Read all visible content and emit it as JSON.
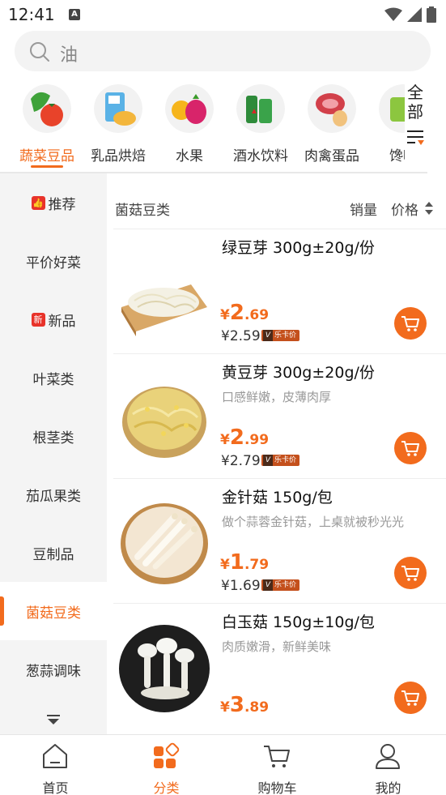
{
  "status_bar": {
    "time": "12:41",
    "a_icon": "A"
  },
  "search": {
    "text": "油"
  },
  "categories": [
    {
      "label": "蔬菜豆品",
      "active": true
    },
    {
      "label": "乳品烘焙",
      "active": false
    },
    {
      "label": "水果",
      "active": false
    },
    {
      "label": "酒水饮料",
      "active": false
    },
    {
      "label": "肉禽蛋品",
      "active": false
    },
    {
      "label": "馋嘴",
      "active": false
    }
  ],
  "category_all": {
    "line1": "全",
    "line2": "部"
  },
  "sidebar": {
    "items": [
      {
        "label": "推荐",
        "badge": "👍",
        "active": false
      },
      {
        "label": "平价好菜",
        "badge": "",
        "active": false
      },
      {
        "label": "新品",
        "badge": "新",
        "active": false
      },
      {
        "label": "叶菜类",
        "badge": "",
        "active": false
      },
      {
        "label": "根茎类",
        "badge": "",
        "active": false
      },
      {
        "label": "茄瓜果类",
        "badge": "",
        "active": false
      },
      {
        "label": "豆制品",
        "badge": "",
        "active": false
      },
      {
        "label": "菌菇豆类",
        "badge": "",
        "active": true
      },
      {
        "label": "葱蒜调味",
        "badge": "",
        "active": false
      }
    ]
  },
  "list_header": {
    "title": "菌菇豆类",
    "sort_sales": "销量",
    "sort_price": "价格"
  },
  "products": [
    {
      "name": "绿豆芽 300g±20g/份",
      "desc": "",
      "yen": "¥",
      "price_int": "2",
      "price_dec": ".69",
      "card_price": "¥2.59",
      "card_label": "乐卡价"
    },
    {
      "name": "黄豆芽 300g±20g/份",
      "desc": "口感鲜嫩，皮薄肉厚",
      "yen": "¥",
      "price_int": "2",
      "price_dec": ".99",
      "card_price": "¥2.79",
      "card_label": "乐卡价"
    },
    {
      "name": "金针菇 150g/包",
      "desc": "做个蒜蓉金针菇，上桌就被秒光光",
      "yen": "¥",
      "price_int": "1",
      "price_dec": ".79",
      "card_price": "¥1.69",
      "card_label": "乐卡价"
    },
    {
      "name": "白玉菇 150g±10g/包",
      "desc": "肉质嫩滑，新鲜美味",
      "yen": "¥",
      "price_int": "3",
      "price_dec": ".89",
      "card_price": "",
      "card_label": ""
    }
  ],
  "bottom_nav": [
    {
      "label": "首页",
      "icon": "home-icon",
      "active": false
    },
    {
      "label": "分类",
      "icon": "category-icon",
      "active": true
    },
    {
      "label": "购物车",
      "icon": "cart-icon",
      "active": false
    },
    {
      "label": "我的",
      "icon": "user-icon",
      "active": false
    }
  ],
  "colors": {
    "accent": "#f26b1d",
    "sidebar_bg": "#f4f4f4",
    "badge_red": "#e8332a"
  }
}
